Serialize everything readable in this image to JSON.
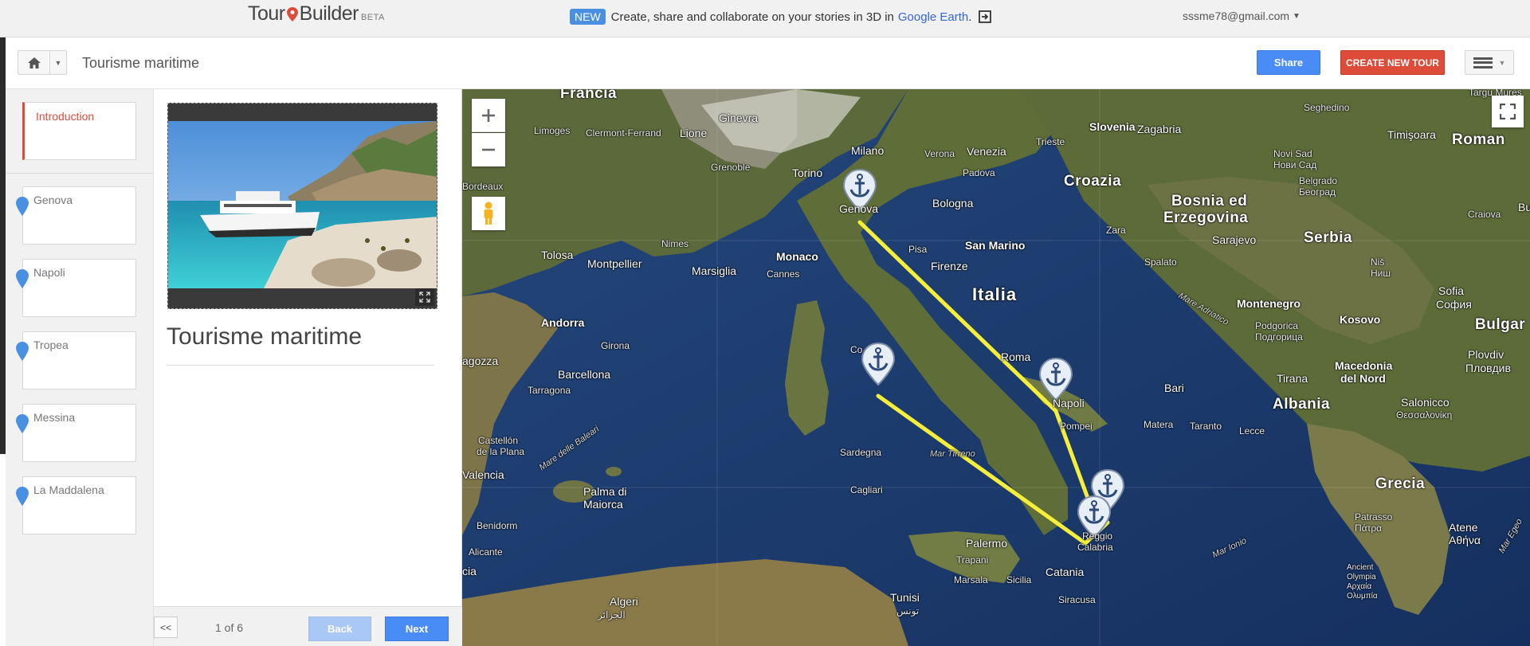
{
  "header": {
    "logo_part1": "Tour",
    "logo_part2": "Builder",
    "logo_beta": "BETA",
    "promo_badge": "NEW",
    "promo_text": "Create, share and collaborate on your stories in 3D in",
    "promo_link": "Google Earth",
    "promo_after": ".",
    "account_email": "sssme78@gmail.com"
  },
  "toolbar": {
    "tour_title": "Tourisme maritime",
    "share_label": "Share",
    "create_label": "CREATE NEW TOUR"
  },
  "sidebar": {
    "intro_label": "Introduction",
    "stops": [
      {
        "label": "Genova"
      },
      {
        "label": "Napoli"
      },
      {
        "label": "Tropea"
      },
      {
        "label": "Messina"
      },
      {
        "label": "La Maddalena"
      }
    ]
  },
  "content": {
    "title": "Tourisme maritime"
  },
  "nav": {
    "first_label": "<<",
    "page_indicator": "1 of 6",
    "back_label": "Back",
    "next_label": "Next"
  },
  "map": {
    "labels": {
      "francia": "Francia",
      "italia": "Italia",
      "croazia": "Croazia",
      "bosnia1": "Bosnia ed",
      "bosnia2": "Erzegovina",
      "serbia": "Serbia",
      "slovenia": "Slovenia",
      "albania": "Albania",
      "grecia": "Grecia",
      "montenegro": "Montenegro",
      "kosovo": "Kosovo",
      "bulgar": "Bulgar",
      "roman": "Roman",
      "macedonia1": "Macedonia",
      "macedonia2": "del Nord",
      "milano": "Milano",
      "torino": "Torino",
      "genova": "Genova",
      "venezia": "Venezia",
      "bologna": "Bologna",
      "firenze": "Firenze",
      "sanmarino": "San Marino",
      "pisa": "Pisa",
      "roma": "Roma",
      "napoli": "Napoli",
      "bari": "Bari",
      "taranto": "Taranto",
      "lecce": "Lecce",
      "matera": "Matera",
      "pompei": "Pompei",
      "palermo": "Palermo",
      "catania": "Catania",
      "messina1": "Reggio",
      "messina2": "Calabria",
      "sardegna": "Sardegna",
      "cagliari": "Cagliari",
      "monaco": "Monaco",
      "cannes": "Cannes",
      "marsiglia": "Marsiglia",
      "montpellier": "Montpellier",
      "nimes": "Nimes",
      "tolosa": "Tolosa",
      "andorra": "Andorra",
      "girona": "Girona",
      "barcellona": "Barcellona",
      "tarragona": "Tarragona",
      "valencia": "Valencia",
      "castellon1": "Castellón",
      "castellon2": "de la Plana",
      "palma1": "Palma di",
      "palma2": "Maiorca",
      "benidorm": "Benidorm",
      "alicante": "Alicante",
      "algeri1": "Algeri",
      "algeri2": "الجزائر",
      "tunisi1": "Tunisi",
      "tunisi2": "تونس",
      "limoges": "Limoges",
      "clermont": "Clermont-Ferrand",
      "lione": "Lione",
      "ginevra": "Ginevra",
      "grenoble": "Grenoble",
      "verona": "Verona",
      "padova": "Padova",
      "trieste": "Trieste",
      "zagabria": "Zagabria",
      "zara": "Zara",
      "spalato": "Spalato",
      "sarajevo": "Sarajevo",
      "seghedino": "Seghedino",
      "timisoara": "Timişoara",
      "novisad1": "Novi Sad",
      "novisad2": "Нови Сад",
      "belgrado1": "Belgrado",
      "belgrado2": "Београд",
      "nis1": "Niš",
      "nis2": "Ниш",
      "sofia1": "Sofia",
      "sofia2": "София",
      "craiova": "Craiova",
      "podgorica1": "Podgorica",
      "podgorica2": "Подгорица",
      "tirana": "Tirana",
      "salonicco1": "Salonicco",
      "salonicco2": "Θεσσαλονίκη",
      "plovdiv1": "Plovdiv",
      "plovdiv2": "Пловдив",
      "patrasso1": "Patrasso",
      "patrasso2": "Πάτρα",
      "atene1": "Atene",
      "atene2": "Αθήνα",
      "olympia1": "Ancient",
      "olympia2": "Olympia",
      "olympia3": "Αρχαία",
      "olympia4": "Ολυμπία",
      "trapani": "Trapani",
      "marsala": "Marsala",
      "sicilia": "Sicilia",
      "siracusa": "Siracusa",
      "bordeaux": "Bordeaux",
      "ragozza": "agozza",
      "targu": "Targu Mures",
      "cia": "cia",
      "co": "Co",
      "bu": "Bu",
      "sea_adriatico": "Mare Adriatico",
      "sea_tirreno": "Mar Tirreno",
      "sea_baleari": "Mare delle Baleari",
      "sea_ionio": "Mar Ionio",
      "sea_egeo": "Mar Egeo"
    }
  },
  "colors": {
    "accent_red": "#dd4b39",
    "accent_blue": "#4a8cf6",
    "route_yellow": "#f5ee3a",
    "marker_blue": "#4a90e2"
  }
}
